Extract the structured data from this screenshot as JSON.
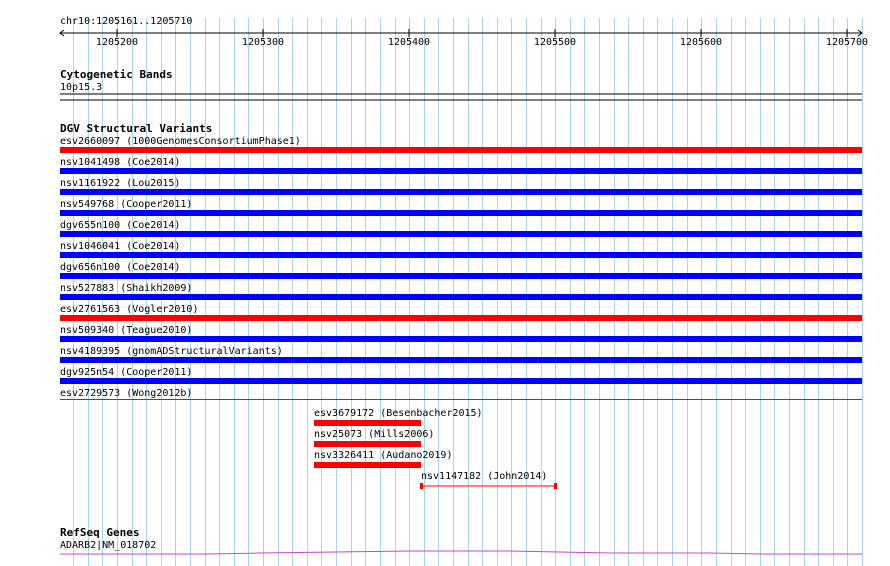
{
  "ruler": {
    "label": "chr10:1205161..1205710",
    "start": 1205161,
    "end": 1205710,
    "ticks": [
      1205200,
      1205300,
      1205400,
      1205500,
      1205600,
      1205700
    ]
  },
  "cytoband_track": {
    "title": "Cytogenetic Bands",
    "band": "10p15.3"
  },
  "dgv_track": {
    "title": "DGV Structural Variants",
    "full_rows": [
      {
        "label": "esv2660097 (1000GenomesConsortiumPhase1)",
        "color": "#ff0000"
      },
      {
        "label": "nsv1041498 (Coe2014)",
        "color": "#0000ff"
      },
      {
        "label": "nsv1161922 (Lou2015)",
        "color": "#0000ff"
      },
      {
        "label": "nsv549768 (Cooper2011)",
        "color": "#0000ff"
      },
      {
        "label": "dgv655n100 (Coe2014)",
        "color": "#0000ff"
      },
      {
        "label": "nsv1046041 (Coe2014)",
        "color": "#0000ff"
      },
      {
        "label": "dgv656n100 (Coe2014)",
        "color": "#0000ff"
      },
      {
        "label": "nsv527883 (Shaikh2009)",
        "color": "#0000ff"
      },
      {
        "label": "esv2761563 (Vogler2010)",
        "color": "#ff0000"
      },
      {
        "label": "nsv509340 (Teague2010)",
        "color": "#0000ff"
      },
      {
        "label": "nsv4189395 (gnomADStructuralVariants)",
        "color": "#0000ff"
      },
      {
        "label": "dgv925n54 (Cooper2011)",
        "color": "#0000ff"
      },
      {
        "label": "esv2729573 (Wong2012b)",
        "color": "#ff0000"
      }
    ],
    "partial_features": [
      {
        "label": "esv3679172 (Besenbacher2015)",
        "start": 1205335,
        "end": 1205408,
        "color": "#ff0000"
      },
      {
        "label": "nsv25073 (Mills2006)",
        "start": 1205335,
        "end": 1205408,
        "color": "#ff0000"
      },
      {
        "label": "nsv3326411 (Audano2019)",
        "start": 1205335,
        "end": 1205408,
        "color": "#ff0000"
      },
      {
        "label": "nsv1147182 (John2014)",
        "start": 1205408,
        "end": 1205500,
        "color": "#ff0000"
      }
    ]
  },
  "refseq_track": {
    "title": "RefSeq Genes",
    "gene": "ADARB2|NM_018702",
    "color": "#cc44cc"
  },
  "colors": {
    "grid": "#a6d6e8",
    "ruler": "#000000"
  }
}
